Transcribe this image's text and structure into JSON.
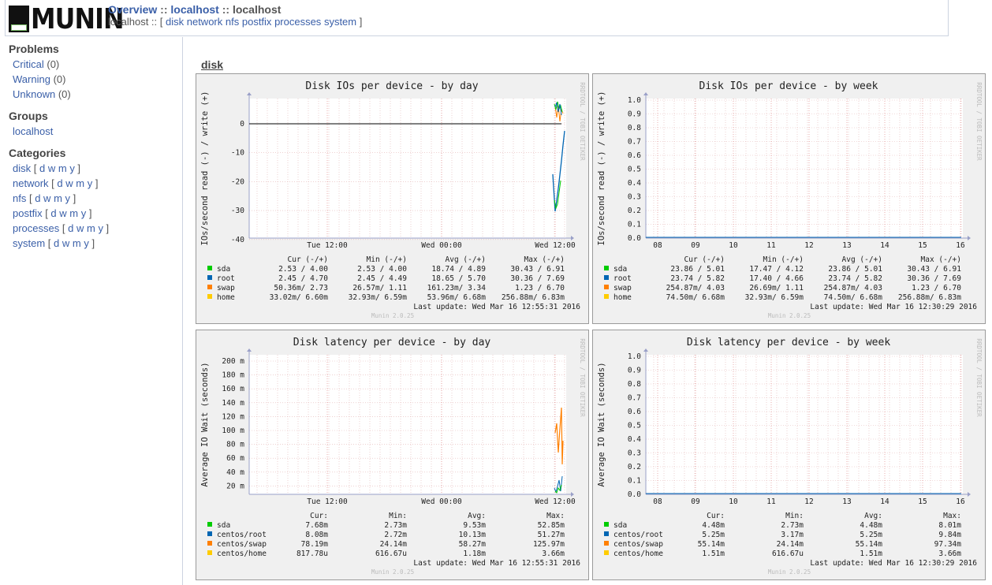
{
  "header": {
    "logo_text": "MUNIN",
    "crumbs": [
      "Overview",
      "localhost",
      "localhost"
    ],
    "crumb_sep": " :: ",
    "subnav_host": "localhost",
    "subnav_sep": " :: [ ",
    "subnav_links": [
      "disk",
      "network",
      "nfs",
      "postfix",
      "processes",
      "system"
    ],
    "subnav_end": " ]"
  },
  "sidebar": {
    "problems_title": "Problems",
    "problems": [
      {
        "label": "Critical",
        "count": "(0)"
      },
      {
        "label": "Warning",
        "count": "(0)"
      },
      {
        "label": "Unknown",
        "count": "(0)"
      }
    ],
    "groups_title": "Groups",
    "groups": [
      "localhost"
    ],
    "categories_title": "Categories",
    "categories": [
      "disk",
      "network",
      "nfs",
      "postfix",
      "processes",
      "system"
    ],
    "period_links": [
      "d",
      "w",
      "m",
      "y"
    ]
  },
  "section_title": "disk",
  "graphs": [
    {
      "title": "Disk IOs per device - by day",
      "ylabel": "IOs/second read (-) / write (+)",
      "side": "RRDTOOL / TOBI OETIKER",
      "y_ticks": [
        "0",
        "-10",
        "-20",
        "-30",
        "-40"
      ],
      "x_ticks": [
        "Tue 12:00",
        "Wed 00:00",
        "Wed 12:00"
      ],
      "headers": [
        "Cur (-/+)",
        "Min (-/+)",
        "Avg (-/+)",
        "Max (-/+)"
      ],
      "legend": [
        {
          "name": "sda",
          "color": "#00cc00",
          "values": [
            "2.53 /  4.00",
            "2.53 /  4.00",
            "18.74 /  4.89",
            "30.43 /  6.91"
          ]
        },
        {
          "name": "root",
          "color": "#0066b3",
          "values": [
            "2.45 /  4.70",
            "2.45 /  4.49",
            "18.65 /  5.70",
            "30.36 /  7.69"
          ]
        },
        {
          "name": "swap",
          "color": "#ff8000",
          "values": [
            "50.36m/  2.73",
            "26.57m/  1.11",
            "161.23m/  3.34",
            "1.23 /  6.70"
          ]
        },
        {
          "name": "home",
          "color": "#ffcc00",
          "values": [
            "33.02m/  6.60m",
            "32.93m/  6.59m",
            "53.96m/  6.68m",
            "256.88m/  6.83m"
          ]
        }
      ],
      "last_update": "Last update: Wed Mar 16 12:55:31 2016",
      "version": "Munin 2.0.25"
    },
    {
      "title": "Disk IOs per device - by week",
      "ylabel": "IOs/second read (-) / write (+)",
      "side": "RRDTOOL / TOBI OETIKER",
      "y_ticks": [
        "1.0",
        "0.9",
        "0.8",
        "0.7",
        "0.6",
        "0.5",
        "0.4",
        "0.3",
        "0.2",
        "0.1",
        "0.0"
      ],
      "x_ticks": [
        "08",
        "09",
        "10",
        "11",
        "12",
        "13",
        "14",
        "15",
        "16"
      ],
      "headers": [
        "Cur (-/+)",
        "Min (-/+)",
        "Avg (-/+)",
        "Max (-/+)"
      ],
      "legend": [
        {
          "name": "sda",
          "color": "#00cc00",
          "values": [
            "23.86 /  5.01",
            "17.47 /  4.12",
            "23.86 /  5.01",
            "30.43 /  6.91"
          ]
        },
        {
          "name": "root",
          "color": "#0066b3",
          "values": [
            "23.74 /  5.82",
            "17.40 /  4.66",
            "23.74 /  5.82",
            "30.36 /  7.69"
          ]
        },
        {
          "name": "swap",
          "color": "#ff8000",
          "values": [
            "254.87m/  4.03",
            "26.69m/  1.11",
            "254.87m/  4.03",
            "1.23 /  6.70"
          ]
        },
        {
          "name": "home",
          "color": "#ffcc00",
          "values": [
            "74.50m/  6.68m",
            "32.93m/  6.59m",
            "74.50m/  6.68m",
            "256.88m/  6.83m"
          ]
        }
      ],
      "last_update": "Last update: Wed Mar 16 12:30:29 2016",
      "version": "Munin 2.0.25"
    },
    {
      "title": "Disk latency per device - by day",
      "ylabel": "Average IO Wait (seconds)",
      "side": "RRDTOOL / TOBI OETIKER",
      "y_ticks": [
        "200 m",
        "180 m",
        "160 m",
        "140 m",
        "120 m",
        "100 m",
        "80 m",
        "60 m",
        "40 m",
        "20 m"
      ],
      "x_ticks": [
        "Tue 12:00",
        "Wed 00:00",
        "Wed 12:00"
      ],
      "headers": [
        "Cur:",
        "Min:",
        "Avg:",
        "Max:"
      ],
      "legend": [
        {
          "name": "sda",
          "color": "#00cc00",
          "values": [
            "7.68m",
            "2.73m",
            "9.53m",
            "52.85m"
          ]
        },
        {
          "name": "centos/root",
          "color": "#0066b3",
          "values": [
            "8.08m",
            "2.72m",
            "10.13m",
            "51.27m"
          ]
        },
        {
          "name": "centos/swap",
          "color": "#ff8000",
          "values": [
            "78.19m",
            "24.14m",
            "58.27m",
            "125.97m"
          ]
        },
        {
          "name": "centos/home",
          "color": "#ffcc00",
          "values": [
            "817.78u",
            "616.67u",
            "1.18m",
            "3.66m"
          ]
        }
      ],
      "last_update": "Last update: Wed Mar 16 12:55:31 2016",
      "version": "Munin 2.0.25"
    },
    {
      "title": "Disk latency per device - by week",
      "ylabel": "Average IO Wait (seconds)",
      "side": "RRDTOOL / TOBI OETIKER",
      "y_ticks": [
        "1.0",
        "0.9",
        "0.8",
        "0.7",
        "0.6",
        "0.5",
        "0.4",
        "0.3",
        "0.2",
        "0.1",
        "0.0"
      ],
      "x_ticks": [
        "08",
        "09",
        "10",
        "11",
        "12",
        "13",
        "14",
        "15",
        "16"
      ],
      "headers": [
        "Cur:",
        "Min:",
        "Avg:",
        "Max:"
      ],
      "legend": [
        {
          "name": "sda",
          "color": "#00cc00",
          "values": [
            "4.48m",
            "2.73m",
            "4.48m",
            "8.01m"
          ]
        },
        {
          "name": "centos/root",
          "color": "#0066b3",
          "values": [
            "5.25m",
            "3.17m",
            "5.25m",
            "9.84m"
          ]
        },
        {
          "name": "centos/swap",
          "color": "#ff8000",
          "values": [
            "55.14m",
            "24.14m",
            "55.14m",
            "97.34m"
          ]
        },
        {
          "name": "centos/home",
          "color": "#ffcc00",
          "values": [
            "1.51m",
            "616.67u",
            "1.51m",
            "3.66m"
          ]
        }
      ],
      "last_update": "Last update: Wed Mar 16 12:30:29 2016",
      "version": "Munin 2.0.25"
    }
  ]
}
